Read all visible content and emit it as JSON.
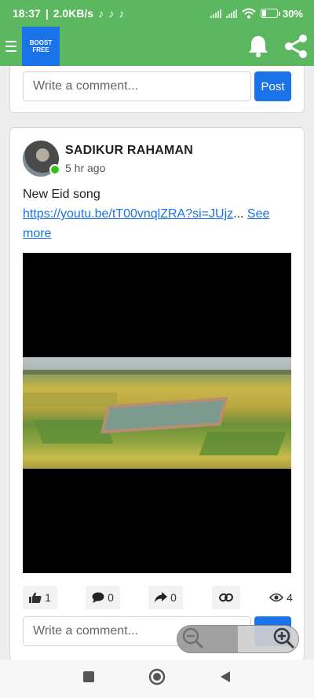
{
  "status_bar": {
    "time": "18:37",
    "net_speed": "2.0KB/s",
    "battery_text": "30%"
  },
  "app_bar": {
    "logo_text": "BOOST FREE"
  },
  "top_card": {
    "comment_placeholder": "Write a comment...",
    "post_label": "Post"
  },
  "post": {
    "author": "SADIKUR RAHAMAN",
    "time": "5 hr ago",
    "text": "New Eid song",
    "link_text": "https://youtu.be/tT00vnqlZRA?si=JUjz",
    "ellipsis": "...",
    "see_more": "See more",
    "likes": "1",
    "comments": "0",
    "shares": "0",
    "views": "4",
    "comment_placeholder": "Write a comment..."
  },
  "colors": {
    "app_green": "#5cb860",
    "accent_blue": "#1a73e8",
    "online_green": "#34c11a"
  }
}
